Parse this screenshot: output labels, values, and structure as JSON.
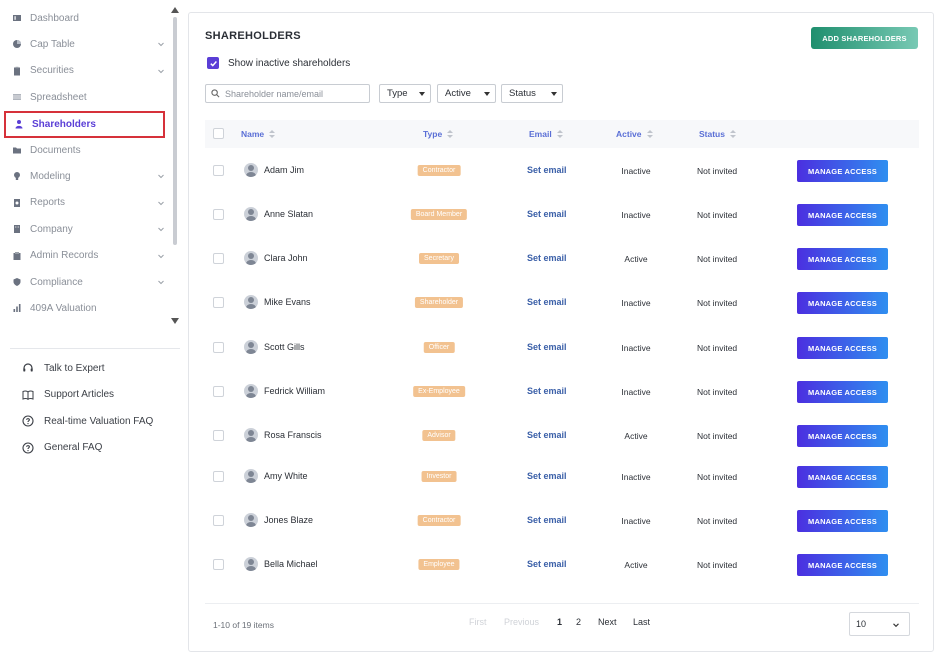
{
  "sidebar": {
    "nav": [
      {
        "label": "Dashboard",
        "icon": "dashboard-icon",
        "has_chevron": false
      },
      {
        "label": "Cap Table",
        "icon": "pie-chart-icon",
        "has_chevron": true
      },
      {
        "label": "Securities",
        "icon": "clipboard-icon",
        "has_chevron": true
      },
      {
        "label": "Spreadsheet",
        "icon": "spreadsheet-icon",
        "has_chevron": false
      },
      {
        "label": "Shareholders",
        "icon": "person-icon",
        "has_chevron": false,
        "active": true
      },
      {
        "label": "Documents",
        "icon": "folder-icon",
        "has_chevron": false
      },
      {
        "label": "Modeling",
        "icon": "lightbulb-icon",
        "has_chevron": true
      },
      {
        "label": "Reports",
        "icon": "report-icon",
        "has_chevron": true
      },
      {
        "label": "Company",
        "icon": "building-icon",
        "has_chevron": true
      },
      {
        "label": "Admin Records",
        "icon": "records-icon",
        "has_chevron": true
      },
      {
        "label": "Compliance",
        "icon": "shield-icon",
        "has_chevron": true
      },
      {
        "label": "409A Valuation",
        "icon": "bar-chart-icon",
        "has_chevron": false
      }
    ],
    "help": [
      {
        "label": "Talk to Expert",
        "icon": "headset-icon"
      },
      {
        "label": "Support Articles",
        "icon": "book-icon"
      },
      {
        "label": "Real-time Valuation FAQ",
        "icon": "question-icon"
      },
      {
        "label": "General FAQ",
        "icon": "question-icon"
      }
    ]
  },
  "main": {
    "title": "SHAREHOLDERS",
    "add_button": "ADD SHAREHOLDERS",
    "show_inactive_label": "Show inactive shareholders",
    "search_placeholder": "Shareholder name/email",
    "filters": {
      "type": "Type",
      "active": "Active",
      "status": "Status"
    },
    "columns": {
      "name": "Name",
      "type": "Type",
      "email": "Email",
      "active": "Active",
      "status": "Status"
    },
    "badge_color": "#f2c290",
    "rows": [
      {
        "name": "Adam Jim",
        "type": "Contractor",
        "email": "Set email",
        "active": "Inactive",
        "status": "Not invited",
        "action": "MANAGE ACCESS"
      },
      {
        "name": "Anne Slatan",
        "type": "Board Member",
        "email": "Set email",
        "active": "Inactive",
        "status": "Not invited",
        "action": "MANAGE ACCESS"
      },
      {
        "name": "Clara John",
        "type": "Secretary",
        "email": "Set email",
        "active": "Active",
        "status": "Not invited",
        "action": "MANAGE ACCESS"
      },
      {
        "name": "Mike Evans",
        "type": "Shareholder",
        "email": "Set email",
        "active": "Inactive",
        "status": "Not invited",
        "action": "MANAGE ACCESS"
      },
      {
        "name": "Scott Gills",
        "type": "Officer",
        "email": "Set email",
        "active": "Inactive",
        "status": "Not invited",
        "action": "MANAGE ACCESS"
      },
      {
        "name": "Fedrick William",
        "type": "Ex-Employee",
        "email": "Set email",
        "active": "Inactive",
        "status": "Not invited",
        "action": "MANAGE ACCESS"
      },
      {
        "name": "Rosa Franscis",
        "type": "Advisor",
        "email": "Set email",
        "active": "Active",
        "status": "Not invited",
        "action": "MANAGE ACCESS"
      },
      {
        "name": "Amy White",
        "type": "Investor",
        "email": "Set email",
        "active": "Inactive",
        "status": "Not invited",
        "action": "MANAGE ACCESS"
      },
      {
        "name": "Jones Blaze",
        "type": "Contractor",
        "email": "Set email",
        "active": "Inactive",
        "status": "Not invited",
        "action": "MANAGE ACCESS"
      },
      {
        "name": "Bella Michael",
        "type": "Employee",
        "email": "Set email",
        "active": "Active",
        "status": "Not invited",
        "action": "MANAGE ACCESS"
      }
    ]
  },
  "pagination": {
    "summary": "1-10 of 19 items",
    "first": "First",
    "previous": "Previous",
    "pages": [
      "1",
      "2"
    ],
    "current_page": "1",
    "next": "Next",
    "last": "Last",
    "per_page": "10"
  }
}
